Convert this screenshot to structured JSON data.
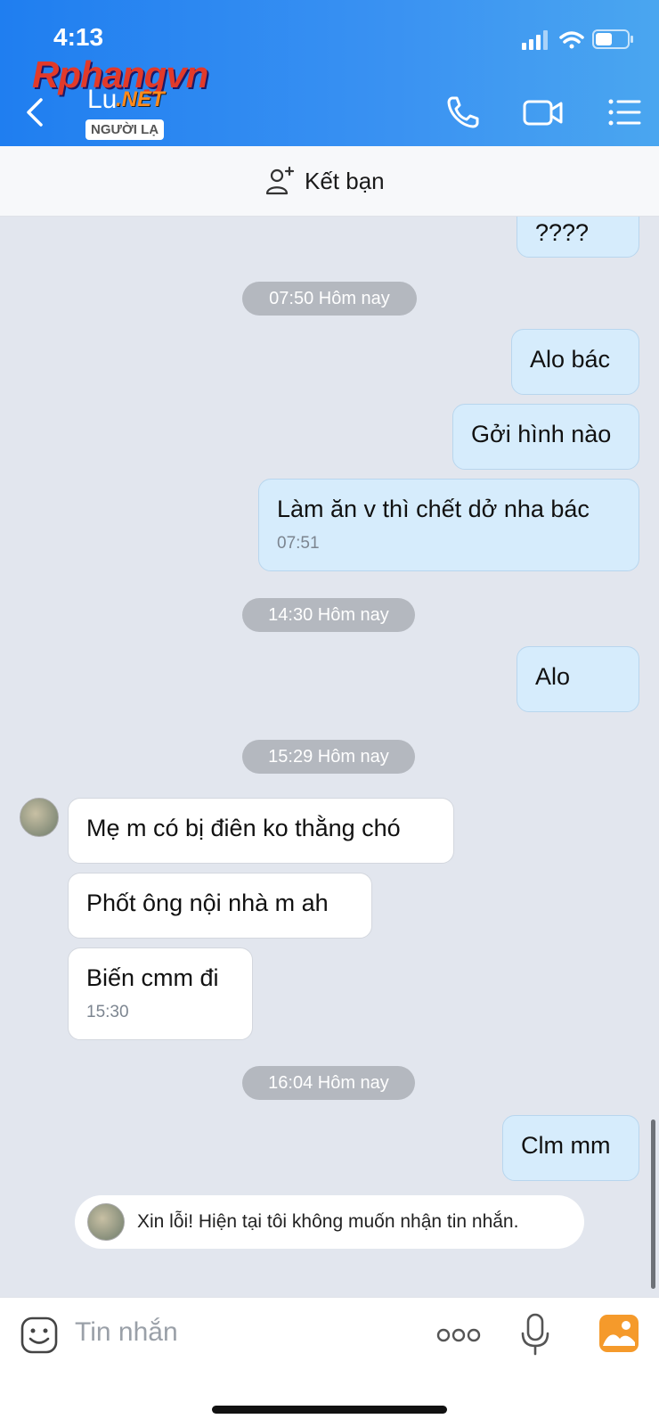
{
  "status": {
    "time": "4:13"
  },
  "watermark": {
    "brand": "Rphangvn",
    "suffix": ".NET"
  },
  "header": {
    "contact_name": "Lu",
    "badge": "NGƯỜI LẠ",
    "icons": [
      "back-icon",
      "phone-icon",
      "video-icon",
      "menu-list-icon"
    ]
  },
  "friend_bar": {
    "label": "Kết bạn",
    "icon": "add-friend-icon"
  },
  "messages": {
    "m0": "????",
    "sep1": "07:50 Hôm nay",
    "m1": "Alo bác",
    "m2": "Gởi hình nào",
    "m3": "Làm ăn v thì chết dở nha bác",
    "m3_time": "07:51",
    "sep2": "14:30 Hôm nay",
    "m4": "Alo",
    "sep3": "15:29 Hôm nay",
    "m5": "Mẹ m có bị điên ko thằng chó",
    "m6": "Phốt ông nội nhà m ah",
    "m7": "Biến cmm đi",
    "m7_time": "15:30",
    "sep4": "16:04 Hôm nay",
    "m8": "Clm mm",
    "notice": "Xin lỗi! Hiện tại tôi không muốn nhận tin nhắn."
  },
  "input": {
    "placeholder": "Tin nhắn",
    "icons": [
      "sticker-icon",
      "more-icon",
      "mic-icon",
      "photo-icon"
    ]
  },
  "colors": {
    "header": "#2a88f1",
    "my_bubble": "#d6ecfc",
    "their_bubble": "#ffffff",
    "background": "#e2e6ee"
  }
}
